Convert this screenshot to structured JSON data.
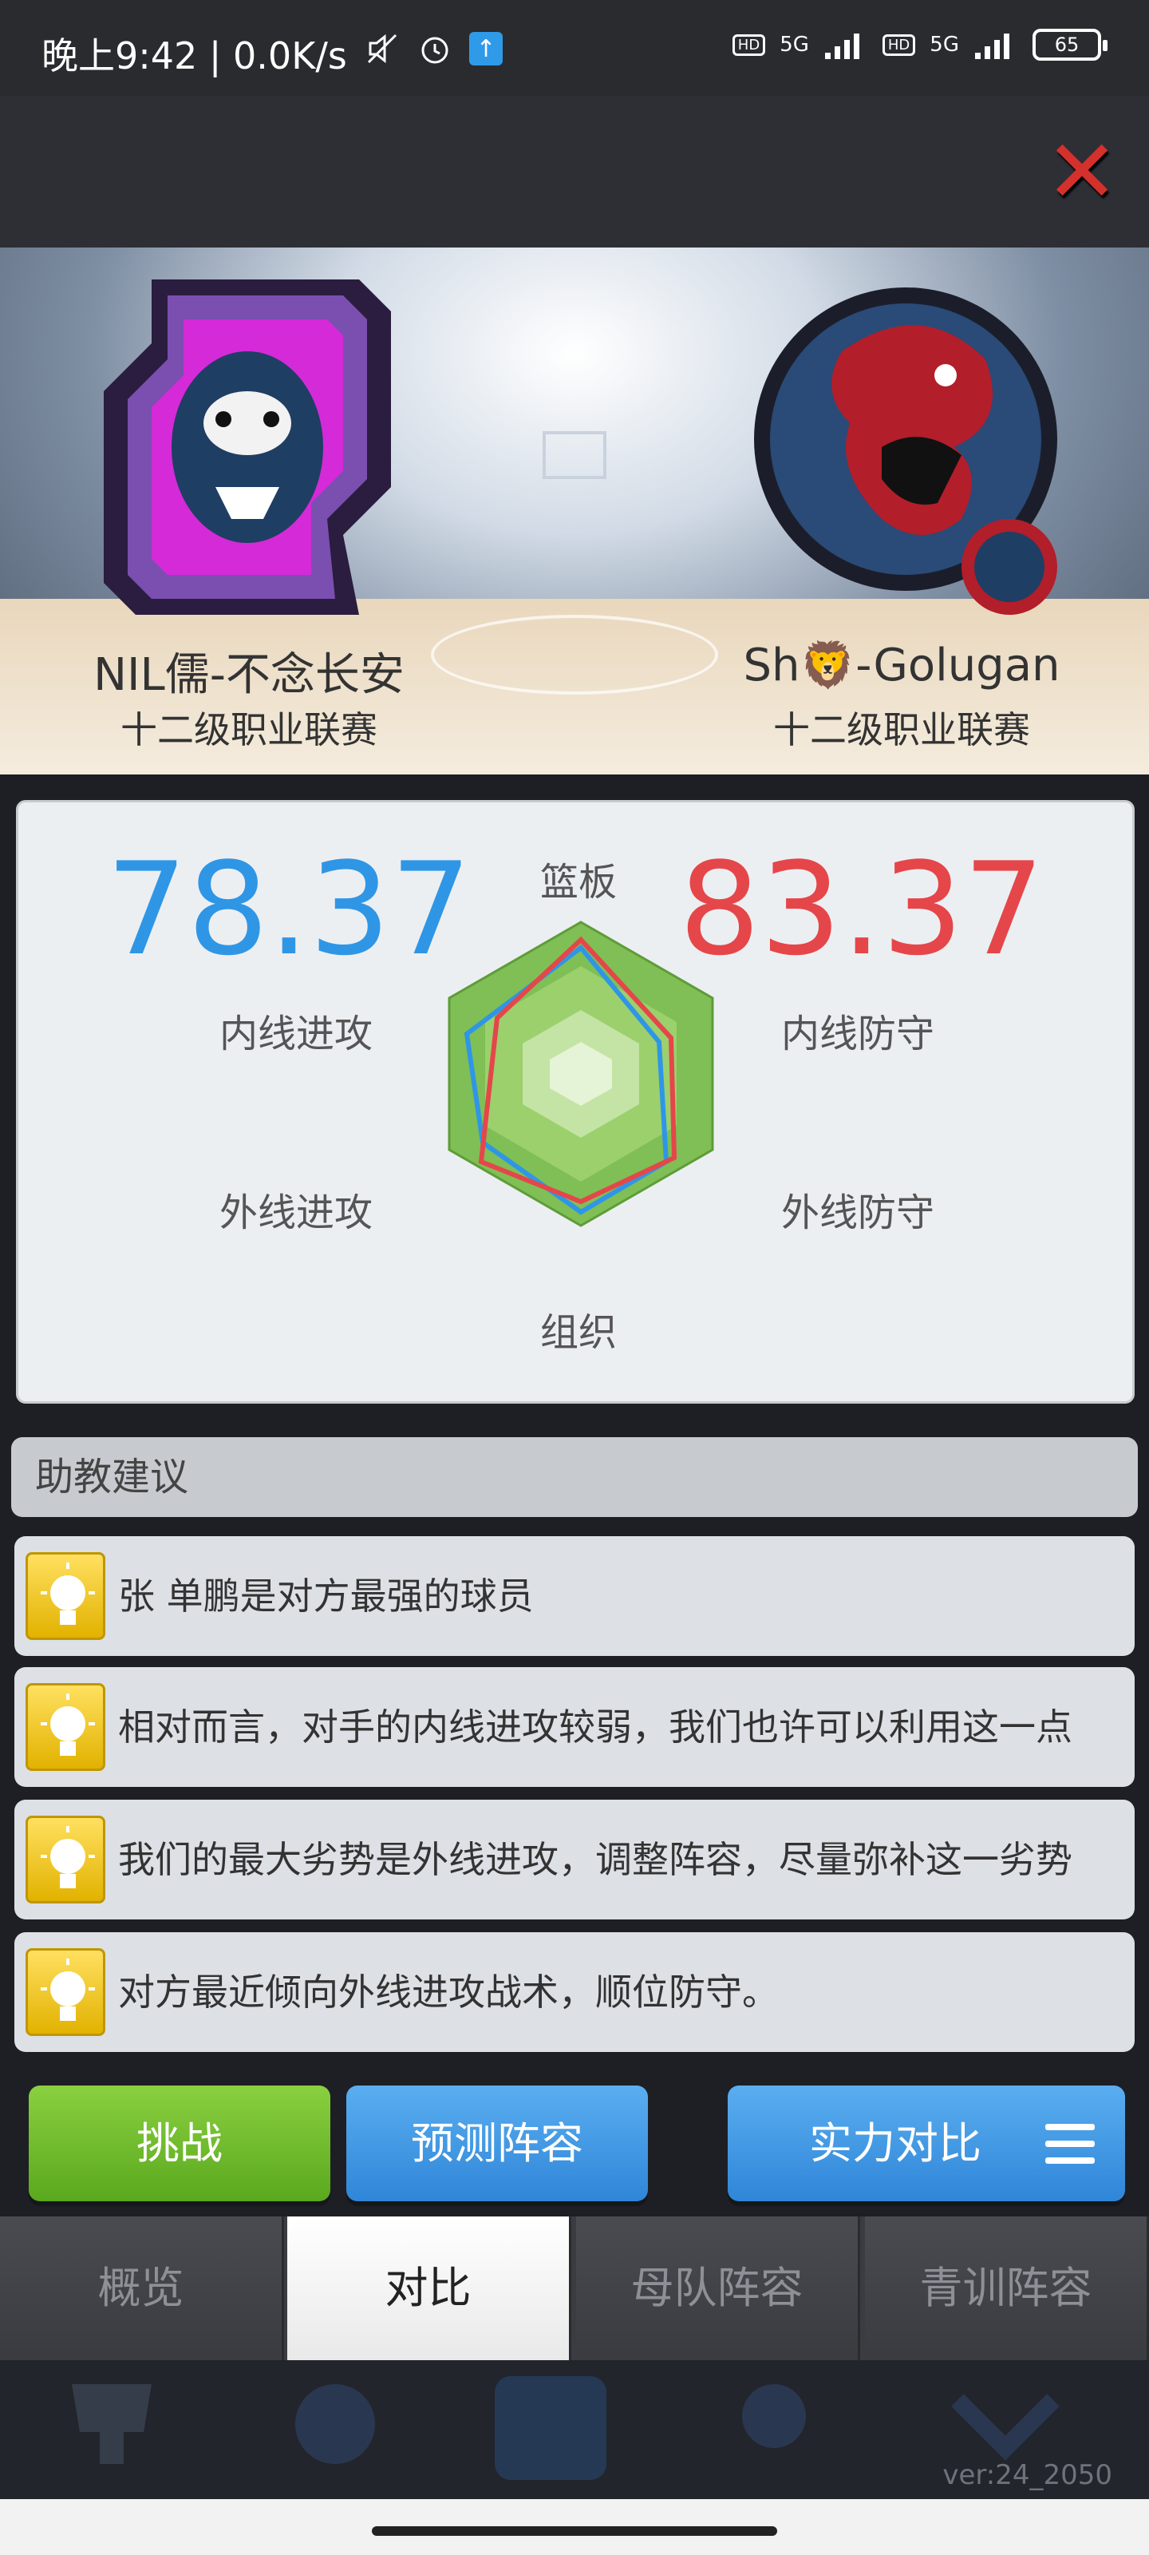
{
  "status_bar": {
    "time": "晚上9:42 | 0.0K/s",
    "network_1": "5G",
    "network_2": "5G",
    "battery": "65"
  },
  "title_bar": {
    "close_icon": "close-x-icon"
  },
  "teams": {
    "left": {
      "name": "NIL儒-不念长安",
      "league": "十二级职业联赛",
      "logo": "tiger-logo"
    },
    "right": {
      "name": "Sh🦁-Golugan",
      "league": "十二级职业联赛",
      "logo": "dinosaur-logo"
    }
  },
  "comparison": {
    "left_score": "78.37",
    "right_score": "83.37",
    "left_color": "#2f96e6",
    "right_color": "#e5464a",
    "axes": {
      "top": "篮板",
      "left_upper": "内线进攻",
      "left_lower": "外线进攻",
      "right_upper": "内线防守",
      "right_lower": "外线防守",
      "bottom": "组织"
    }
  },
  "advice": {
    "header": "助教建议",
    "items": [
      {
        "text": "张 单鹏是对方最强的球员",
        "icon": "lightbulb-icon"
      },
      {
        "text": "相对而言，对手的内线进攻较弱，我们也许可以利用这一点",
        "icon": "lightbulb-icon"
      },
      {
        "text": "我们的最大劣势是外线进攻，调整阵容，尽量弥补这一劣势",
        "icon": "lightbulb-icon"
      },
      {
        "text": "对方最近倾向外线进攻战术，顺位防守。",
        "icon": "lightbulb-icon"
      }
    ]
  },
  "actions": {
    "challenge": "挑战",
    "predict": "预测阵容",
    "power": "实力对比"
  },
  "tabs": [
    {
      "label": "概览",
      "active": false
    },
    {
      "label": "对比",
      "active": true
    },
    {
      "label": "母队阵容",
      "active": false
    },
    {
      "label": "青训阵容",
      "active": false
    }
  ],
  "footer": {
    "version": "ver:24_2050"
  }
}
